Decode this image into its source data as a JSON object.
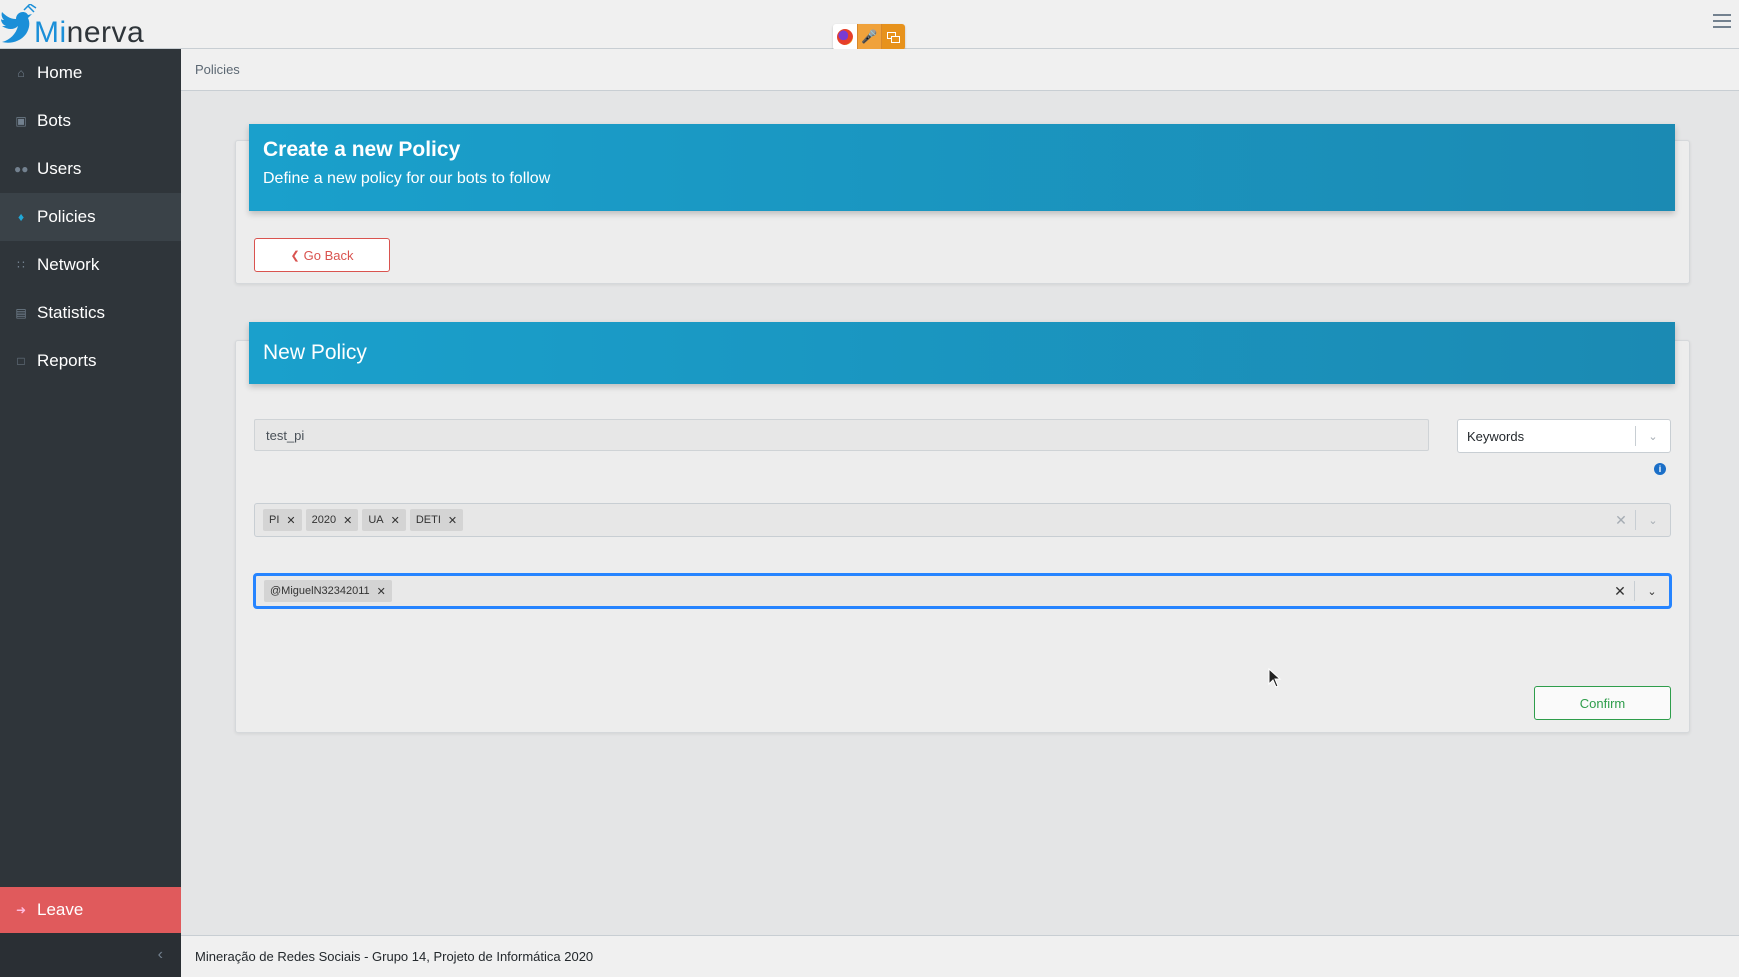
{
  "app": {
    "logo_mi": "Mi",
    "logo_rest": "nerva"
  },
  "sidebar": {
    "items": [
      {
        "label": "Home",
        "icon": "home-icon"
      },
      {
        "label": "Bots",
        "icon": "robot-icon"
      },
      {
        "label": "Users",
        "icon": "users-icon"
      },
      {
        "label": "Policies",
        "icon": "tags-icon",
        "active": true
      },
      {
        "label": "Network",
        "icon": "network-icon"
      },
      {
        "label": "Statistics",
        "icon": "chart-icon"
      },
      {
        "label": "Reports",
        "icon": "file-icon"
      }
    ],
    "leave_label": "Leave",
    "minimizer": "‹"
  },
  "breadcrumb": {
    "current": "Policies"
  },
  "create_card": {
    "title": "Create a new Policy",
    "subtitle": "Define a new policy for our bots to follow",
    "back_label": "Go Back"
  },
  "policy_card": {
    "title": "New Policy",
    "name_value": "test_pi",
    "type_selected": "Keywords",
    "keywords": [
      "PI",
      "2020",
      "UA",
      "DETI"
    ],
    "users": [
      "@MiguelN32342011"
    ],
    "confirm_label": "Confirm"
  },
  "footer": {
    "text": "Mineração de Redes Sociais - Grupo 14, Projeto de Informática 2020"
  },
  "colors": {
    "primary": "#1aa0cc",
    "sidebar": "#2f353a",
    "leave": "#e05a5c",
    "confirm": "#2e9d4b",
    "back": "#d9534f"
  }
}
